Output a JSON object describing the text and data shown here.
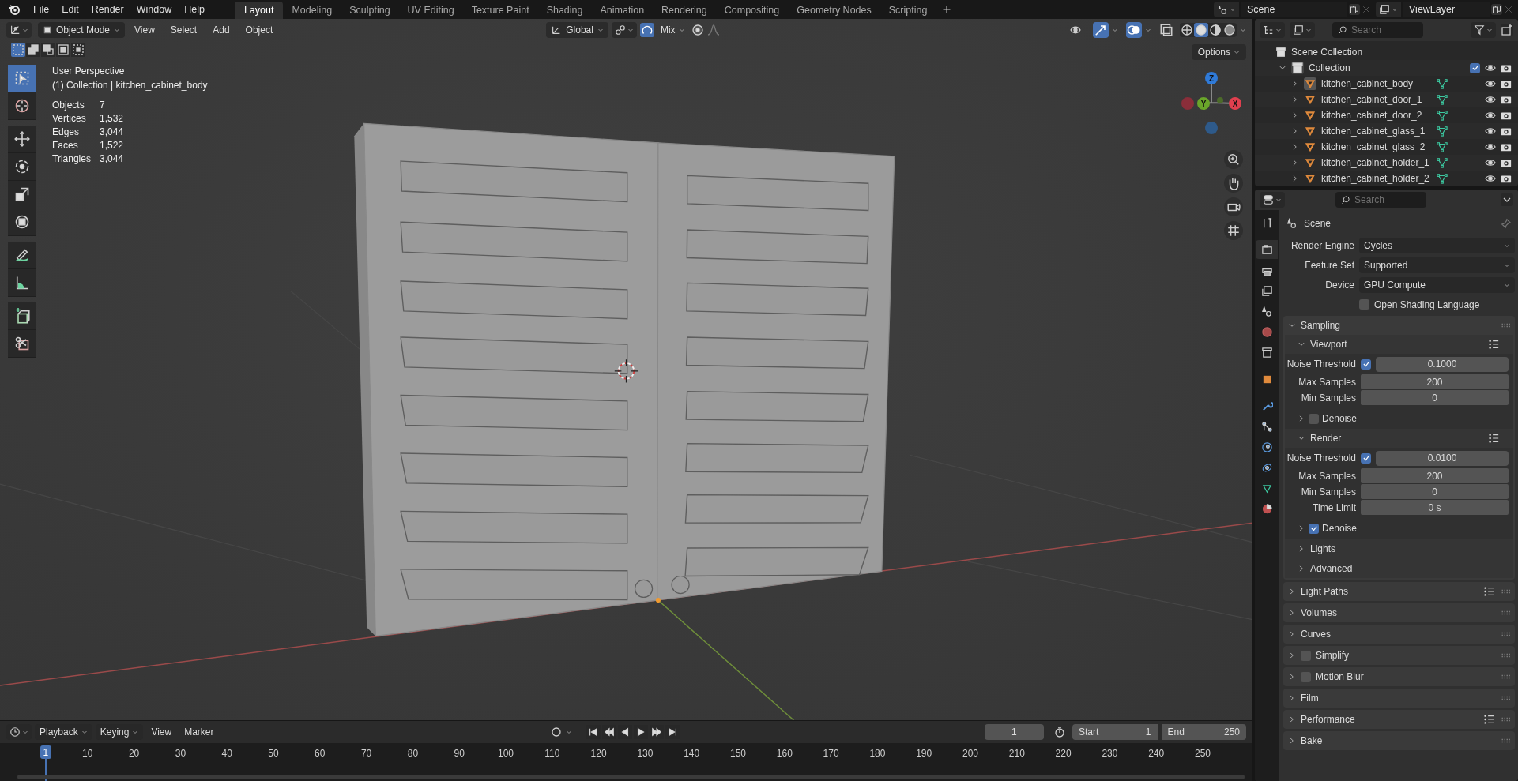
{
  "top_menu": [
    "File",
    "Edit",
    "Render",
    "Window",
    "Help"
  ],
  "workspaces": [
    {
      "label": "Layout",
      "selected": true
    },
    {
      "label": "Modeling",
      "selected": false
    },
    {
      "label": "Sculpting",
      "selected": false
    },
    {
      "label": "UV Editing",
      "selected": false
    },
    {
      "label": "Texture Paint",
      "selected": false
    },
    {
      "label": "Shading",
      "selected": false
    },
    {
      "label": "Animation",
      "selected": false
    },
    {
      "label": "Rendering",
      "selected": false
    },
    {
      "label": "Compositing",
      "selected": false
    },
    {
      "label": "Geometry Nodes",
      "selected": false
    },
    {
      "label": "Scripting",
      "selected": false
    }
  ],
  "scene": "Scene",
  "view_layer": "ViewLayer",
  "viewport": {
    "mode": "Object Mode",
    "menus": [
      "View",
      "Select",
      "Add",
      "Object"
    ],
    "orientation": "Global",
    "snap_mode": "Mix",
    "options": "Options",
    "perspective": "User Perspective",
    "context": "(1) Collection | kitchen_cabinet_body",
    "stats": [
      {
        "label": "Objects",
        "value": "7"
      },
      {
        "label": "Vertices",
        "value": "1,532"
      },
      {
        "label": "Edges",
        "value": "3,044"
      },
      {
        "label": "Faces",
        "value": "1,522"
      },
      {
        "label": "Triangles",
        "value": "3,044"
      }
    ],
    "tools": [
      {
        "selected": true
      },
      {
        "selected": false
      },
      {
        "selected": false
      },
      {
        "selected": false
      },
      {
        "selected": false
      },
      {
        "selected": false
      },
      {
        "selected": false
      },
      {
        "selected": false
      },
      {
        "selected": false
      },
      {
        "selected": false
      }
    ],
    "gizmo_axes": [
      "X",
      "Y",
      "Z"
    ]
  },
  "outliner": {
    "search_placeholder": "Search",
    "scene_collection": "Scene Collection",
    "collection": {
      "name": "Collection",
      "expanded": true,
      "checked": true
    },
    "objects": [
      {
        "name": "kitchen_cabinet_body",
        "active": true
      },
      {
        "name": "kitchen_cabinet_door_1",
        "active": false
      },
      {
        "name": "kitchen_cabinet_door_2",
        "active": false
      },
      {
        "name": "kitchen_cabinet_glass_1",
        "active": false
      },
      {
        "name": "kitchen_cabinet_glass_2",
        "active": false
      },
      {
        "name": "kitchen_cabinet_holder_1",
        "active": false
      },
      {
        "name": "kitchen_cabinet_holder_2",
        "active": false
      }
    ]
  },
  "properties": {
    "search_placeholder": "Search",
    "context": "Scene",
    "tabs": [
      {
        "selected": false
      },
      {
        "selected": true
      },
      {
        "selected": false
      },
      {
        "selected": false
      },
      {
        "selected": false
      },
      {
        "selected": false
      },
      {
        "selected": false
      },
      {
        "selected": false
      },
      {
        "selected": false
      },
      {
        "selected": false
      },
      {
        "selected": false
      },
      {
        "selected": false
      },
      {
        "selected": false
      },
      {
        "selected": false
      }
    ],
    "fields": [
      {
        "label": "Render Engine",
        "value": "Cycles"
      },
      {
        "label": "Feature Set",
        "value": "Supported"
      },
      {
        "label": "Device",
        "value": "GPU Compute"
      }
    ],
    "osl": {
      "label": "Open Shading Language",
      "checked": false
    },
    "sampling": {
      "title": "Sampling",
      "expanded": true,
      "rows": [
        {
          "kind": "subheader",
          "label": "Viewport",
          "expanded": true
        },
        {
          "kind": "check_number",
          "label": "Noise Threshold",
          "checked": true,
          "value": "0.1000"
        },
        {
          "kind": "number",
          "label": "Max Samples",
          "value": "200"
        },
        {
          "kind": "number",
          "label": "Min Samples",
          "value": "0"
        },
        {
          "kind": "subpanel_check",
          "label": "Denoise",
          "checked": false,
          "expanded": false
        },
        {
          "kind": "subheader",
          "label": "Render",
          "expanded": true
        },
        {
          "kind": "check_number",
          "label": "Noise Threshold",
          "checked": true,
          "value": "0.0100"
        },
        {
          "kind": "number",
          "label": "Max Samples",
          "value": "200"
        },
        {
          "kind": "number",
          "label": "Min Samples",
          "value": "0"
        },
        {
          "kind": "number",
          "label": "Time Limit",
          "value": "0 s"
        },
        {
          "kind": "subpanel_check",
          "label": "Denoise",
          "checked": true,
          "expanded": false
        },
        {
          "kind": "subpanel",
          "label": "Lights",
          "expanded": false
        },
        {
          "kind": "subpanel",
          "label": "Advanced",
          "expanded": false
        }
      ]
    },
    "panels": [
      {
        "title": "Light Paths",
        "kind": "plain",
        "presets": true,
        "expanded": false
      },
      {
        "title": "Volumes",
        "kind": "plain",
        "presets": false,
        "expanded": false
      },
      {
        "title": "Curves",
        "kind": "plain",
        "presets": false,
        "expanded": false
      },
      {
        "title": "Simplify",
        "kind": "checkbox",
        "checked": false,
        "presets": false,
        "expanded": false
      },
      {
        "title": "Motion Blur",
        "kind": "checkbox",
        "checked": false,
        "presets": false,
        "expanded": false
      },
      {
        "title": "Film",
        "kind": "plain",
        "presets": false,
        "expanded": false
      },
      {
        "title": "Performance",
        "kind": "plain",
        "presets": true,
        "expanded": false
      },
      {
        "title": "Bake",
        "kind": "plain",
        "presets": false,
        "expanded": false
      }
    ]
  },
  "timeline": {
    "menus": [
      {
        "label": "Playback",
        "dropdown": true
      },
      {
        "label": "Keying",
        "dropdown": true
      },
      {
        "label": "View",
        "dropdown": false
      },
      {
        "label": "Marker",
        "dropdown": false
      }
    ],
    "frame": "1",
    "start_label": "Start",
    "start": "1",
    "end_label": "End",
    "end": "250",
    "playhead": "1",
    "ticks": [
      "10",
      "20",
      "30",
      "40",
      "50",
      "60",
      "70",
      "80",
      "90",
      "100",
      "110",
      "120",
      "130",
      "140",
      "150",
      "160",
      "170",
      "180",
      "190",
      "200",
      "210",
      "220",
      "230",
      "240",
      "250"
    ]
  }
}
